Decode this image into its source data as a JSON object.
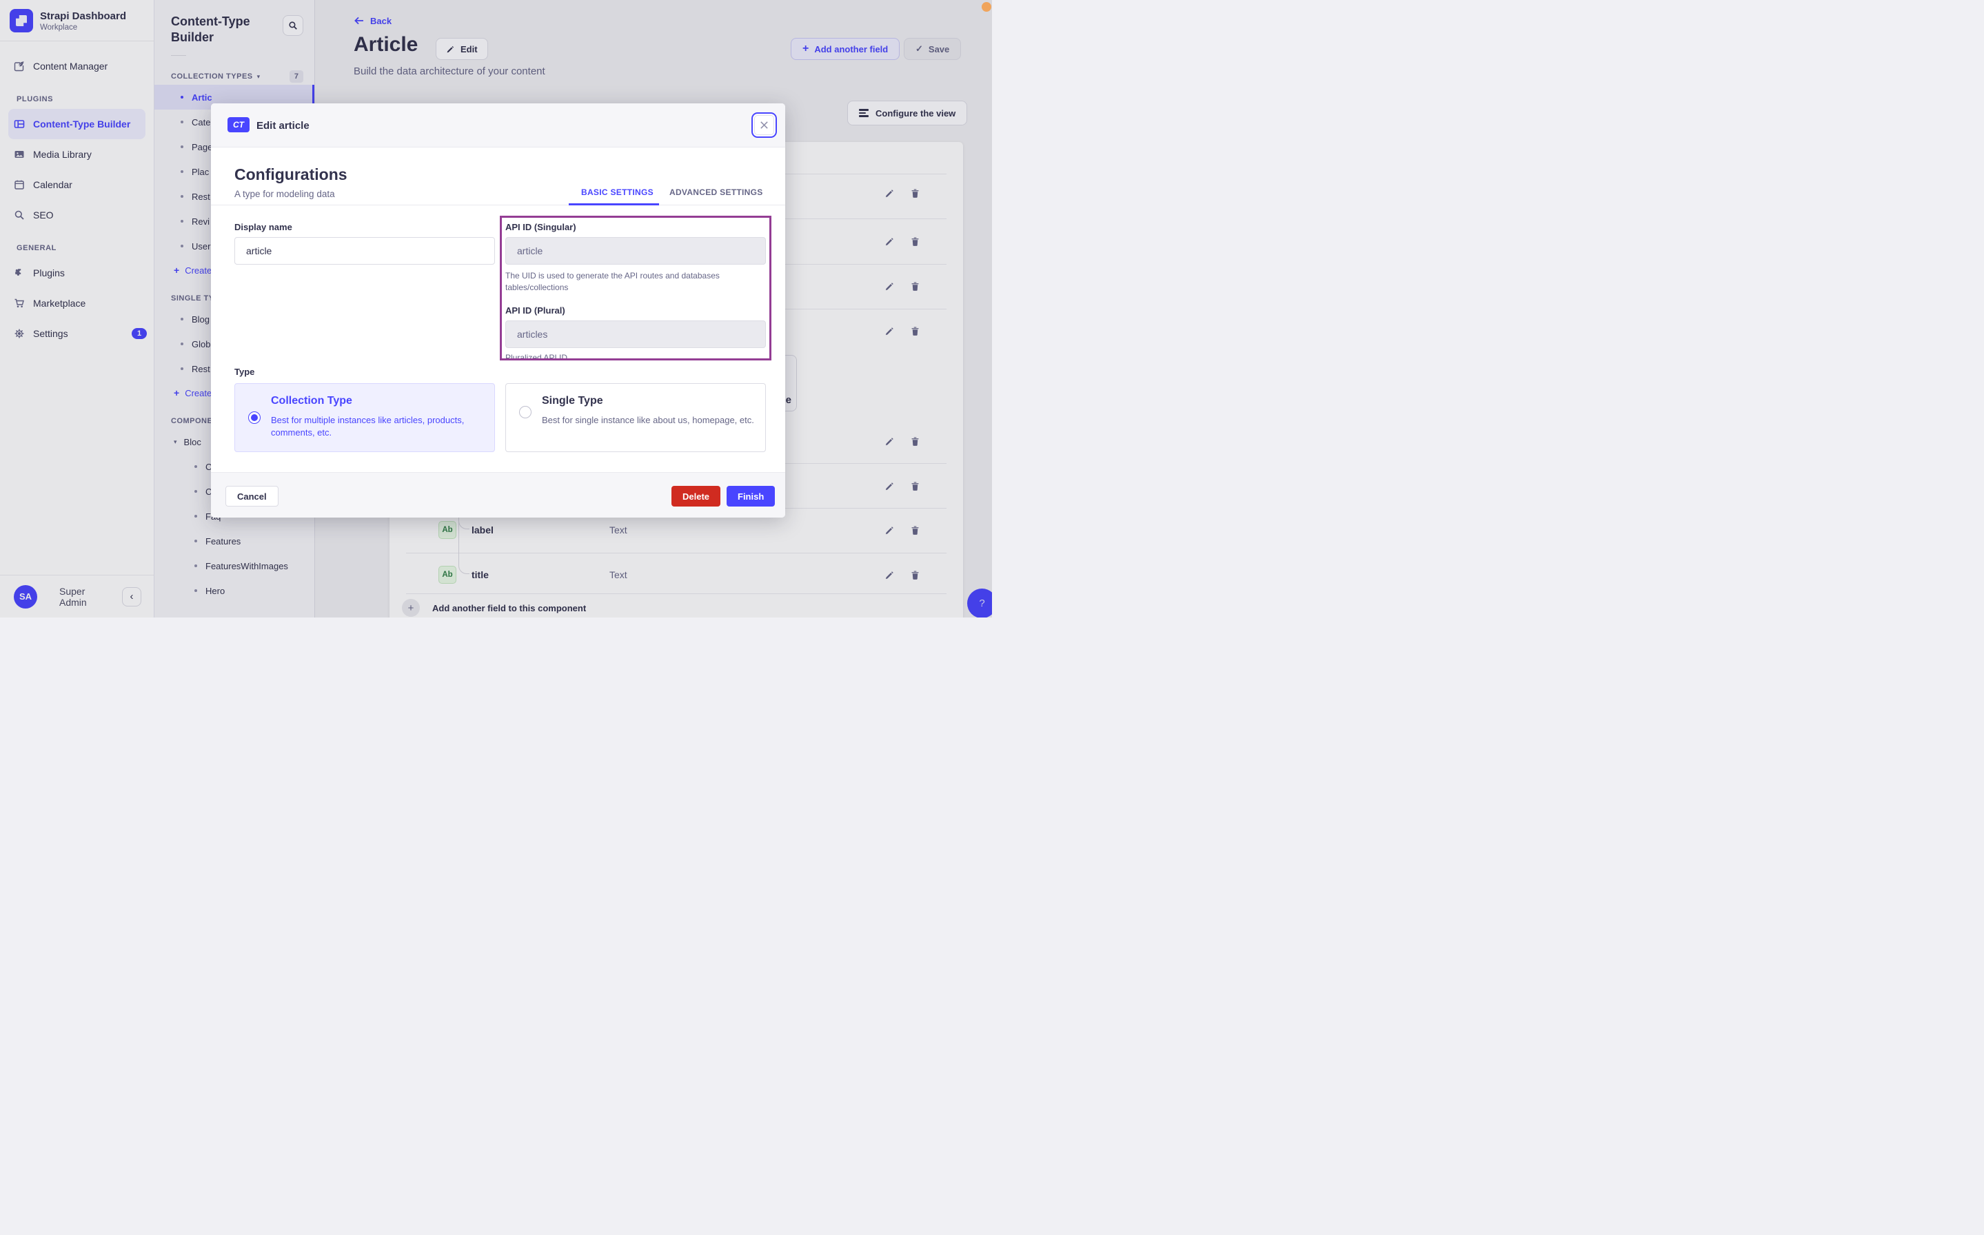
{
  "app": {
    "name": "Strapi Dashboard",
    "workspace": "Workplace"
  },
  "sidebar": {
    "main_item": "Content Manager",
    "sections": [
      {
        "label": "PLUGINS",
        "items": [
          {
            "label": "Content-Type Builder",
            "icon": "layout-grid-icon",
            "active": true
          },
          {
            "label": "Media Library",
            "icon": "picture-icon"
          },
          {
            "label": "Calendar",
            "icon": "calendar-icon"
          },
          {
            "label": "SEO",
            "icon": "search-icon"
          }
        ]
      },
      {
        "label": "GENERAL",
        "items": [
          {
            "label": "Plugins",
            "icon": "puzzle-icon"
          },
          {
            "label": "Marketplace",
            "icon": "cart-icon"
          },
          {
            "label": "Settings",
            "icon": "gear-icon",
            "badge": "1"
          }
        ]
      }
    ],
    "user": {
      "initials": "SA",
      "name": "Super Admin"
    }
  },
  "subnav": {
    "title": "Content-Type Builder",
    "groups": [
      {
        "label": "COLLECTION TYPES",
        "count": "7",
        "items": [
          "Artic",
          "Cate",
          "Page",
          "Plac",
          "Rest",
          "Revi",
          "User"
        ],
        "active_item": "Artic",
        "action": "Create"
      },
      {
        "label": "SINGLE TY",
        "items": [
          "Blog",
          "Glob",
          "Rest"
        ],
        "action": "Create"
      },
      {
        "label": "COMPONE",
        "toggle_item": "Bloc",
        "items": [
          "Ct",
          "Ct",
          "Faq",
          "Features",
          "FeaturesWithImages",
          "Hero"
        ]
      }
    ]
  },
  "header": {
    "back": "Back",
    "title": "Article",
    "edit": "Edit",
    "subtitle": "Build the data architecture of your content",
    "add_field": "Add another field",
    "save": "Save",
    "configure": "Configure the view"
  },
  "content": {
    "rows": [
      {
        "badge": "Ab",
        "name": "label",
        "type": "Text"
      },
      {
        "badge": "Ab",
        "name": "title",
        "type": "Text"
      }
    ],
    "add_row_label": "Add another field to this component",
    "partial_button_text": "e",
    "help_label": "?"
  },
  "modal": {
    "badge": "CT",
    "title": "Edit article",
    "heading": "Configurations",
    "subheading": "A type for modeling data",
    "tabs": [
      {
        "label": "BASIC SETTINGS",
        "active": true
      },
      {
        "label": "ADVANCED SETTINGS",
        "active": false
      }
    ],
    "display_name": {
      "label": "Display name",
      "value": "article"
    },
    "api_singular": {
      "label": "API ID (Singular)",
      "value": "article",
      "helper": "The UID is used to generate the API routes and databases tables/collections"
    },
    "api_plural": {
      "label": "API ID (Plural)",
      "value": "articles",
      "helper": "Pluralized API ID"
    },
    "type_label": "Type",
    "options": [
      {
        "title": "Collection Type",
        "desc": "Best for multiple instances like articles, products, comments, etc.",
        "selected": true
      },
      {
        "title": "Single Type",
        "desc": "Best for single instance like about us, homepage, etc.",
        "selected": false
      }
    ],
    "cancel": "Cancel",
    "delete": "Delete",
    "finish": "Finish"
  },
  "glyphs": {
    "check": "✓",
    "plus": "+",
    "caret_down": "▾",
    "chevron_left": "‹",
    "bullet": "•",
    "question": "?"
  },
  "colors": {
    "primary": "#4945ff",
    "danger": "#d02b20",
    "annotation_box": "#943d94",
    "field_badge_green": "#328048",
    "record_indicator": "#f0a45b"
  }
}
